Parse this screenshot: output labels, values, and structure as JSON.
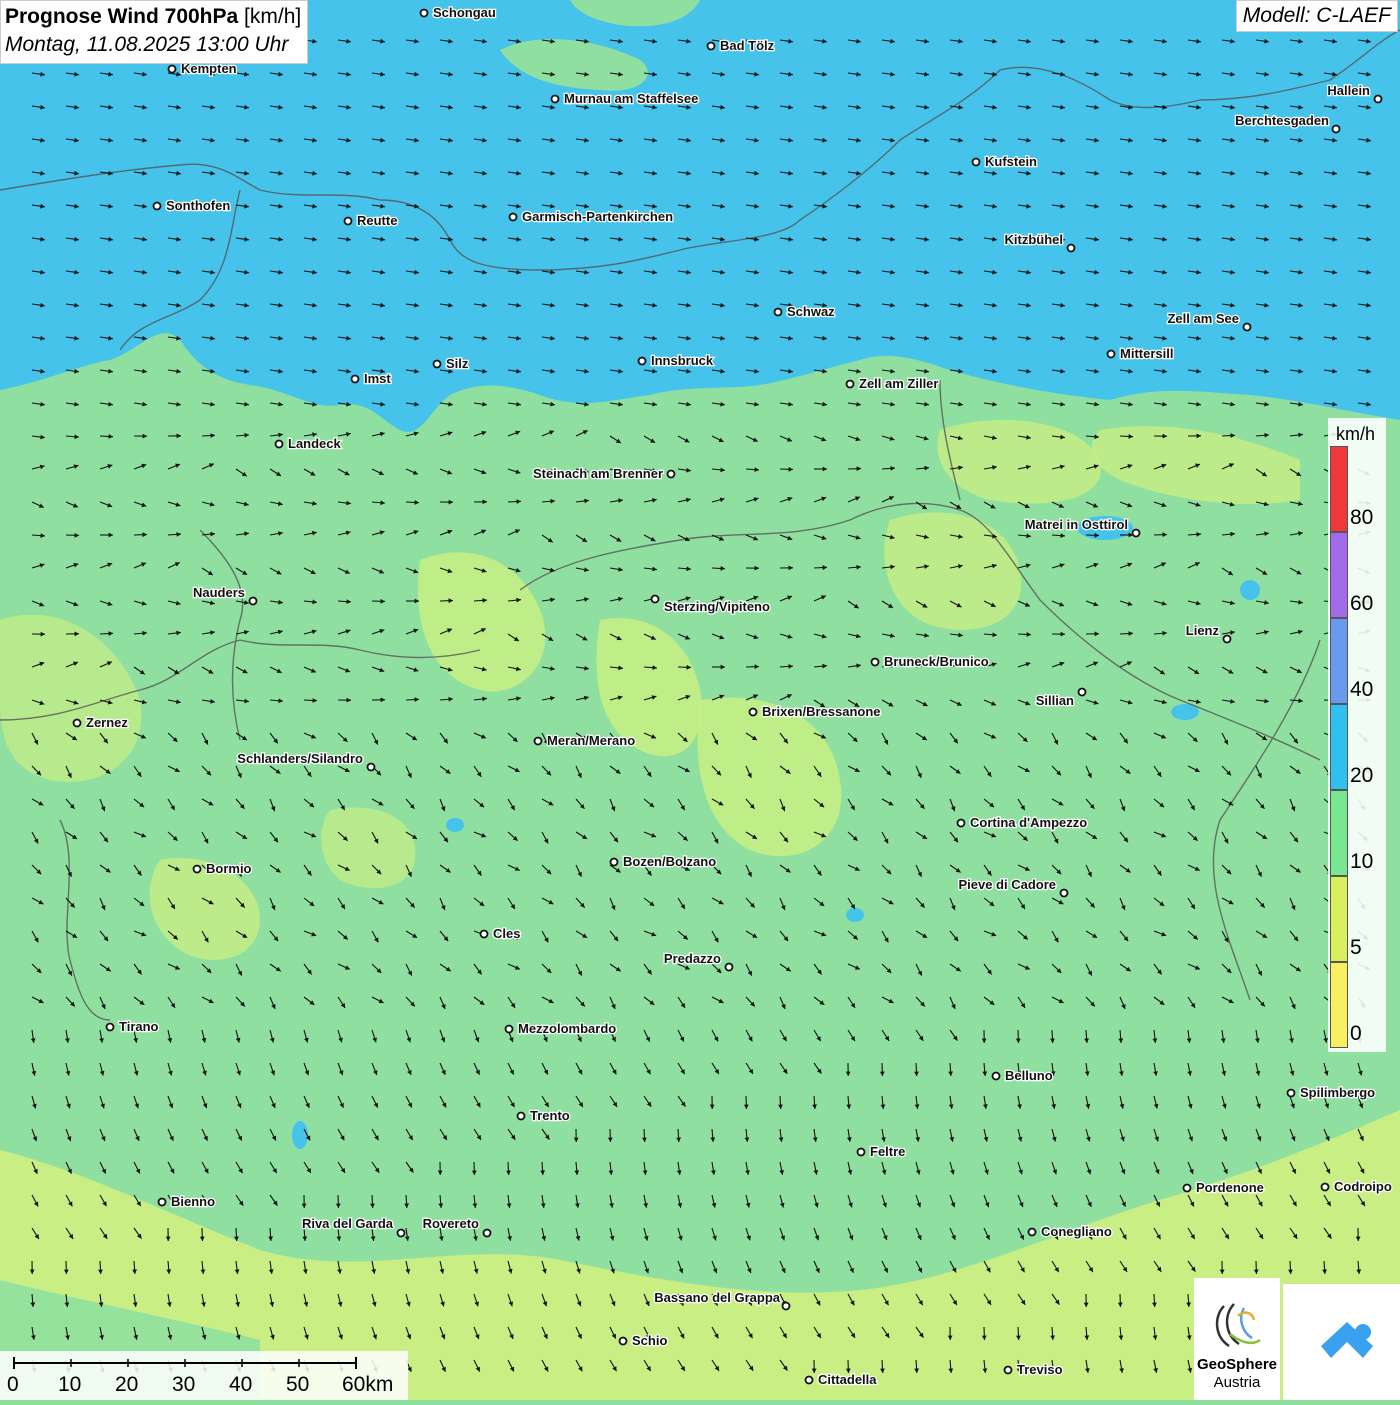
{
  "title": {
    "main": "Prognose Wind 700hPa",
    "unit": "[km/h]",
    "datetime": "Montag, 11.08.2025 13:00 Uhr"
  },
  "model": "Modell: C-LAEF",
  "legend": {
    "unit": "km/h",
    "labels": [
      "80",
      "60",
      "40",
      "20",
      "10",
      "5",
      "0"
    ],
    "colors": [
      "#f0383a",
      "#a06ae8",
      "#6a9af0",
      "#30c0f0",
      "#78e890",
      "#d8f060",
      "#f8f060"
    ]
  },
  "scale": {
    "ticks": [
      "0",
      "10",
      "20",
      "30",
      "40",
      "50",
      "60km"
    ]
  },
  "logo": {
    "name1": "GeoSphere",
    "name2": "Austria"
  },
  "cities": [
    {
      "name": "Schongau"
    },
    {
      "name": "Bad Tölz"
    },
    {
      "name": "Kempten"
    },
    {
      "name": "Murnau am Staffelsee"
    },
    {
      "name": "Hallein"
    },
    {
      "name": "Berchtesgaden"
    },
    {
      "name": "Kufstein"
    },
    {
      "name": "Sonthofen"
    },
    {
      "name": "Reutte"
    },
    {
      "name": "Garmisch-Partenkirchen"
    },
    {
      "name": "Kitzbühel"
    },
    {
      "name": "Schwaz"
    },
    {
      "name": "Zell am See"
    },
    {
      "name": "Mittersill"
    },
    {
      "name": "Innsbruck"
    },
    {
      "name": "Silz"
    },
    {
      "name": "Imst"
    },
    {
      "name": "Zell am Ziller"
    },
    {
      "name": "Landeck"
    },
    {
      "name": "Steinach am Brenner"
    },
    {
      "name": "Matrei in Osttirol"
    },
    {
      "name": "Nauders"
    },
    {
      "name": "Sterzing/Vipiteno"
    },
    {
      "name": "Lienz"
    },
    {
      "name": "Bruneck/Brunico"
    },
    {
      "name": "Sillian"
    },
    {
      "name": "Zernez"
    },
    {
      "name": "Brixen/Bressanone"
    },
    {
      "name": "Meran/Merano"
    },
    {
      "name": "Schlanders/Silandro"
    },
    {
      "name": "Cortina d'Ampezzo"
    },
    {
      "name": "Bozen/Bolzano"
    },
    {
      "name": "Bormio"
    },
    {
      "name": "Pieve di Cadore"
    },
    {
      "name": "Cles"
    },
    {
      "name": "Predazzo"
    },
    {
      "name": "Tirano"
    },
    {
      "name": "Mezzolombardo"
    },
    {
      "name": "Belluno"
    },
    {
      "name": "Spilimbergo"
    },
    {
      "name": "Trento"
    },
    {
      "name": "Feltre"
    },
    {
      "name": "Bienno"
    },
    {
      "name": "Pordenone"
    },
    {
      "name": "Codroipo"
    },
    {
      "name": "Riva del Garda"
    },
    {
      "name": "Rovereto"
    },
    {
      "name": "Conegliano"
    },
    {
      "name": "Bassano del Grappa"
    },
    {
      "name": "Schio"
    },
    {
      "name": "Treviso"
    },
    {
      "name": "Cittadella"
    }
  ]
}
